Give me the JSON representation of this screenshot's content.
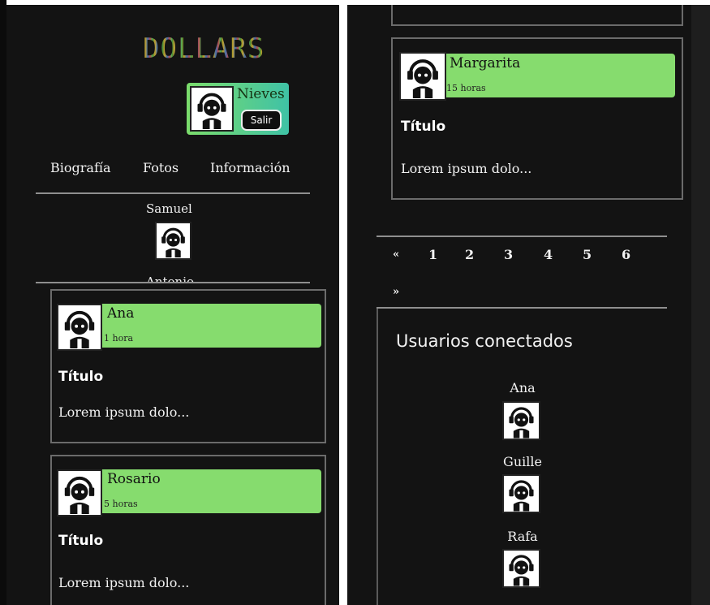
{
  "app": {
    "logo_text": "DOLLARS"
  },
  "current_user": {
    "name": "Nieves",
    "logout_label": "Salir"
  },
  "nav": [
    "Biografía",
    "Fotos",
    "Información"
  ],
  "friends": [
    "Samuel",
    "Antonio"
  ],
  "posts_left": [
    {
      "author": "Ana",
      "time": "1 hora",
      "title": "Título",
      "body": "Lorem ipsum dolo..."
    },
    {
      "author": "Rosario",
      "time": "5 horas",
      "title": "Título",
      "body": "Lorem ipsum dolo..."
    }
  ],
  "post_right": {
    "author": "Margarita",
    "time": "15 horas",
    "title": "Título",
    "body": "Lorem ipsum dolo..."
  },
  "pagination": {
    "prev": "«",
    "pages": [
      "1",
      "2",
      "3",
      "4",
      "5",
      "6"
    ],
    "next": "»"
  },
  "online": {
    "title": "Usuarios conectados",
    "users": [
      "Ana",
      "Guille",
      "Rafa"
    ]
  },
  "colors": {
    "background": "#131313",
    "card_header": "#86dc6e",
    "user_box_start": "#7bdc6b",
    "user_box_end": "#3fc2a6"
  }
}
